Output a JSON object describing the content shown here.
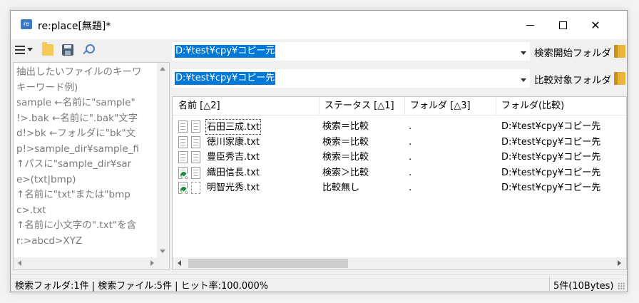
{
  "window": {
    "title": "re:place[無題]*"
  },
  "toolbar": {
    "icons": [
      "hamburger-menu-icon",
      "folder-icon",
      "save-icon",
      "search-icon"
    ]
  },
  "left_pane": {
    "lines": [
      "抽出したいファイルのキーワ",
      "キーワード例)",
      "sample ←名前に\"sample\"",
      "!>.bak ←名前に\".bak\"文字",
      "d!>bk ←フォルダに\"bk\"文",
      "p!>sample_dir¥sample_fi",
      "  ↑パスに\"sample_dir¥sar",
      "e>(txt|bmp)",
      "  ↑名前に\"txt\"または\"bmp",
      "c>.txt",
      "  ↑名前に小文字の\".txt\"を含",
      "r:>abcd>XYZ"
    ]
  },
  "search_path": {
    "value": "D:¥test¥cpy¥コピー元",
    "label": "検索開始フォルダ"
  },
  "compare_path": {
    "value": "D:¥test¥cpy¥コピー先",
    "label": "比較対象フォルダ"
  },
  "file_list": {
    "columns": [
      "名前 [△2]",
      "ステータス [△1]",
      "フォルダ [△3]",
      "フォルダ(比較)"
    ],
    "rows": [
      {
        "name": "石田三成.txt",
        "status": "検索＝比較",
        "folder": ".",
        "compare_folder": "D:¥test¥cpy¥コピー先"
      },
      {
        "name": "徳川家康.txt",
        "status": "検索＝比較",
        "folder": ".",
        "compare_folder": "D:¥test¥cpy¥コピー先"
      },
      {
        "name": "豊臣秀吉.txt",
        "status": "検索＝比較",
        "folder": ".",
        "compare_folder": "D:¥test¥cpy¥コピー先"
      },
      {
        "name": "織田信長.txt",
        "status": "検索＞比較",
        "folder": ".",
        "compare_folder": "D:¥test¥cpy¥コピー先"
      },
      {
        "name": "明智光秀.txt",
        "status": "比較無し",
        "folder": ".",
        "compare_folder": "D:¥test¥cpy¥コピー先"
      }
    ]
  },
  "status_bar": {
    "left": "検索フォルダ:1件 | 検索ファイル:5件 | ヒット率:100.000%",
    "right": "5件(10Bytes)"
  },
  "colors": {
    "selection": "#0078d7",
    "badge_green": "#1a8a3a"
  }
}
